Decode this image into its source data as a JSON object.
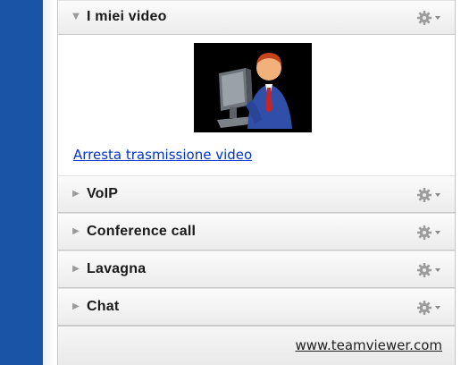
{
  "my_video": {
    "title": "I miei video",
    "stop_link": "Arresta trasmissione video"
  },
  "sections": [
    {
      "label": "VoIP"
    },
    {
      "label": "Conference call"
    },
    {
      "label": "Lavagna"
    },
    {
      "label": "Chat"
    }
  ],
  "footer": {
    "link": "www.teamviewer.com"
  },
  "icons": {
    "expanded": "triangle-down-icon",
    "collapsed": "triangle-right-icon",
    "options": "gear-icon",
    "user": "user-at-computer-icon"
  },
  "colors": {
    "sidebar_blue": "#1a54a6",
    "link_blue": "#0033cc",
    "avatar_bg": "#000000"
  }
}
